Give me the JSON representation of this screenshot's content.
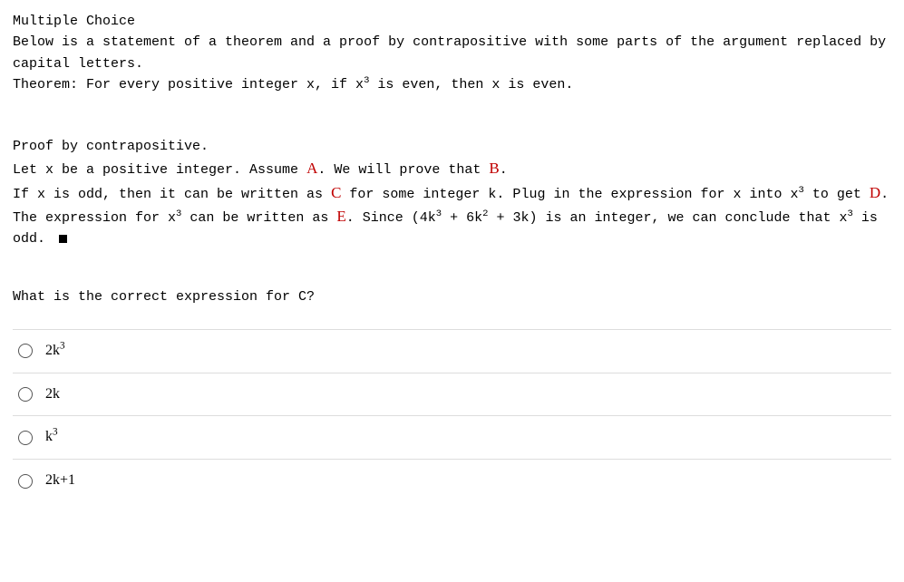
{
  "header": {
    "title": "Multiple Choice",
    "intro": "Below is a statement of a theorem and a proof by contrapositive with some parts of the argument replaced by capital letters.",
    "theorem_prefix": "Theorem: For every positive integer x, if x",
    "theorem_sup": "3",
    "theorem_suffix": " is even, then x is even."
  },
  "proof": {
    "line1": "Proof by contrapositive.",
    "l2_a": "Let x be a positive integer. Assume ",
    "A": "A",
    "l2_b": ". We will prove that ",
    "B": "B",
    "l2_c": ".",
    "l3_a": "If x is odd, then it can be written as ",
    "C": "C",
    "l3_b": " for some integer k. Plug in the expression for x into x",
    "l3_sup1": "3",
    "l3_c": " to get ",
    "D": "D",
    "l3_d": ". The expression for x",
    "l3_sup2": "3",
    "l3_e": " can be written as ",
    "E": "E",
    "l3_f": ". Since (4k",
    "l3_sup3": "3",
    "l3_g": " + 6k",
    "l3_sup4": "2",
    "l3_h": " + 3k) is an integer, we can conclude that x",
    "l3_sup5": "3",
    "l3_i": " is odd.  "
  },
  "question": "What is the correct expression for C?",
  "options": [
    {
      "pre": "2k",
      "sup": "3",
      "post": ""
    },
    {
      "pre": "2k",
      "sup": "",
      "post": ""
    },
    {
      "pre": "k",
      "sup": "3",
      "post": ""
    },
    {
      "pre": "2k+1",
      "sup": "",
      "post": ""
    }
  ]
}
